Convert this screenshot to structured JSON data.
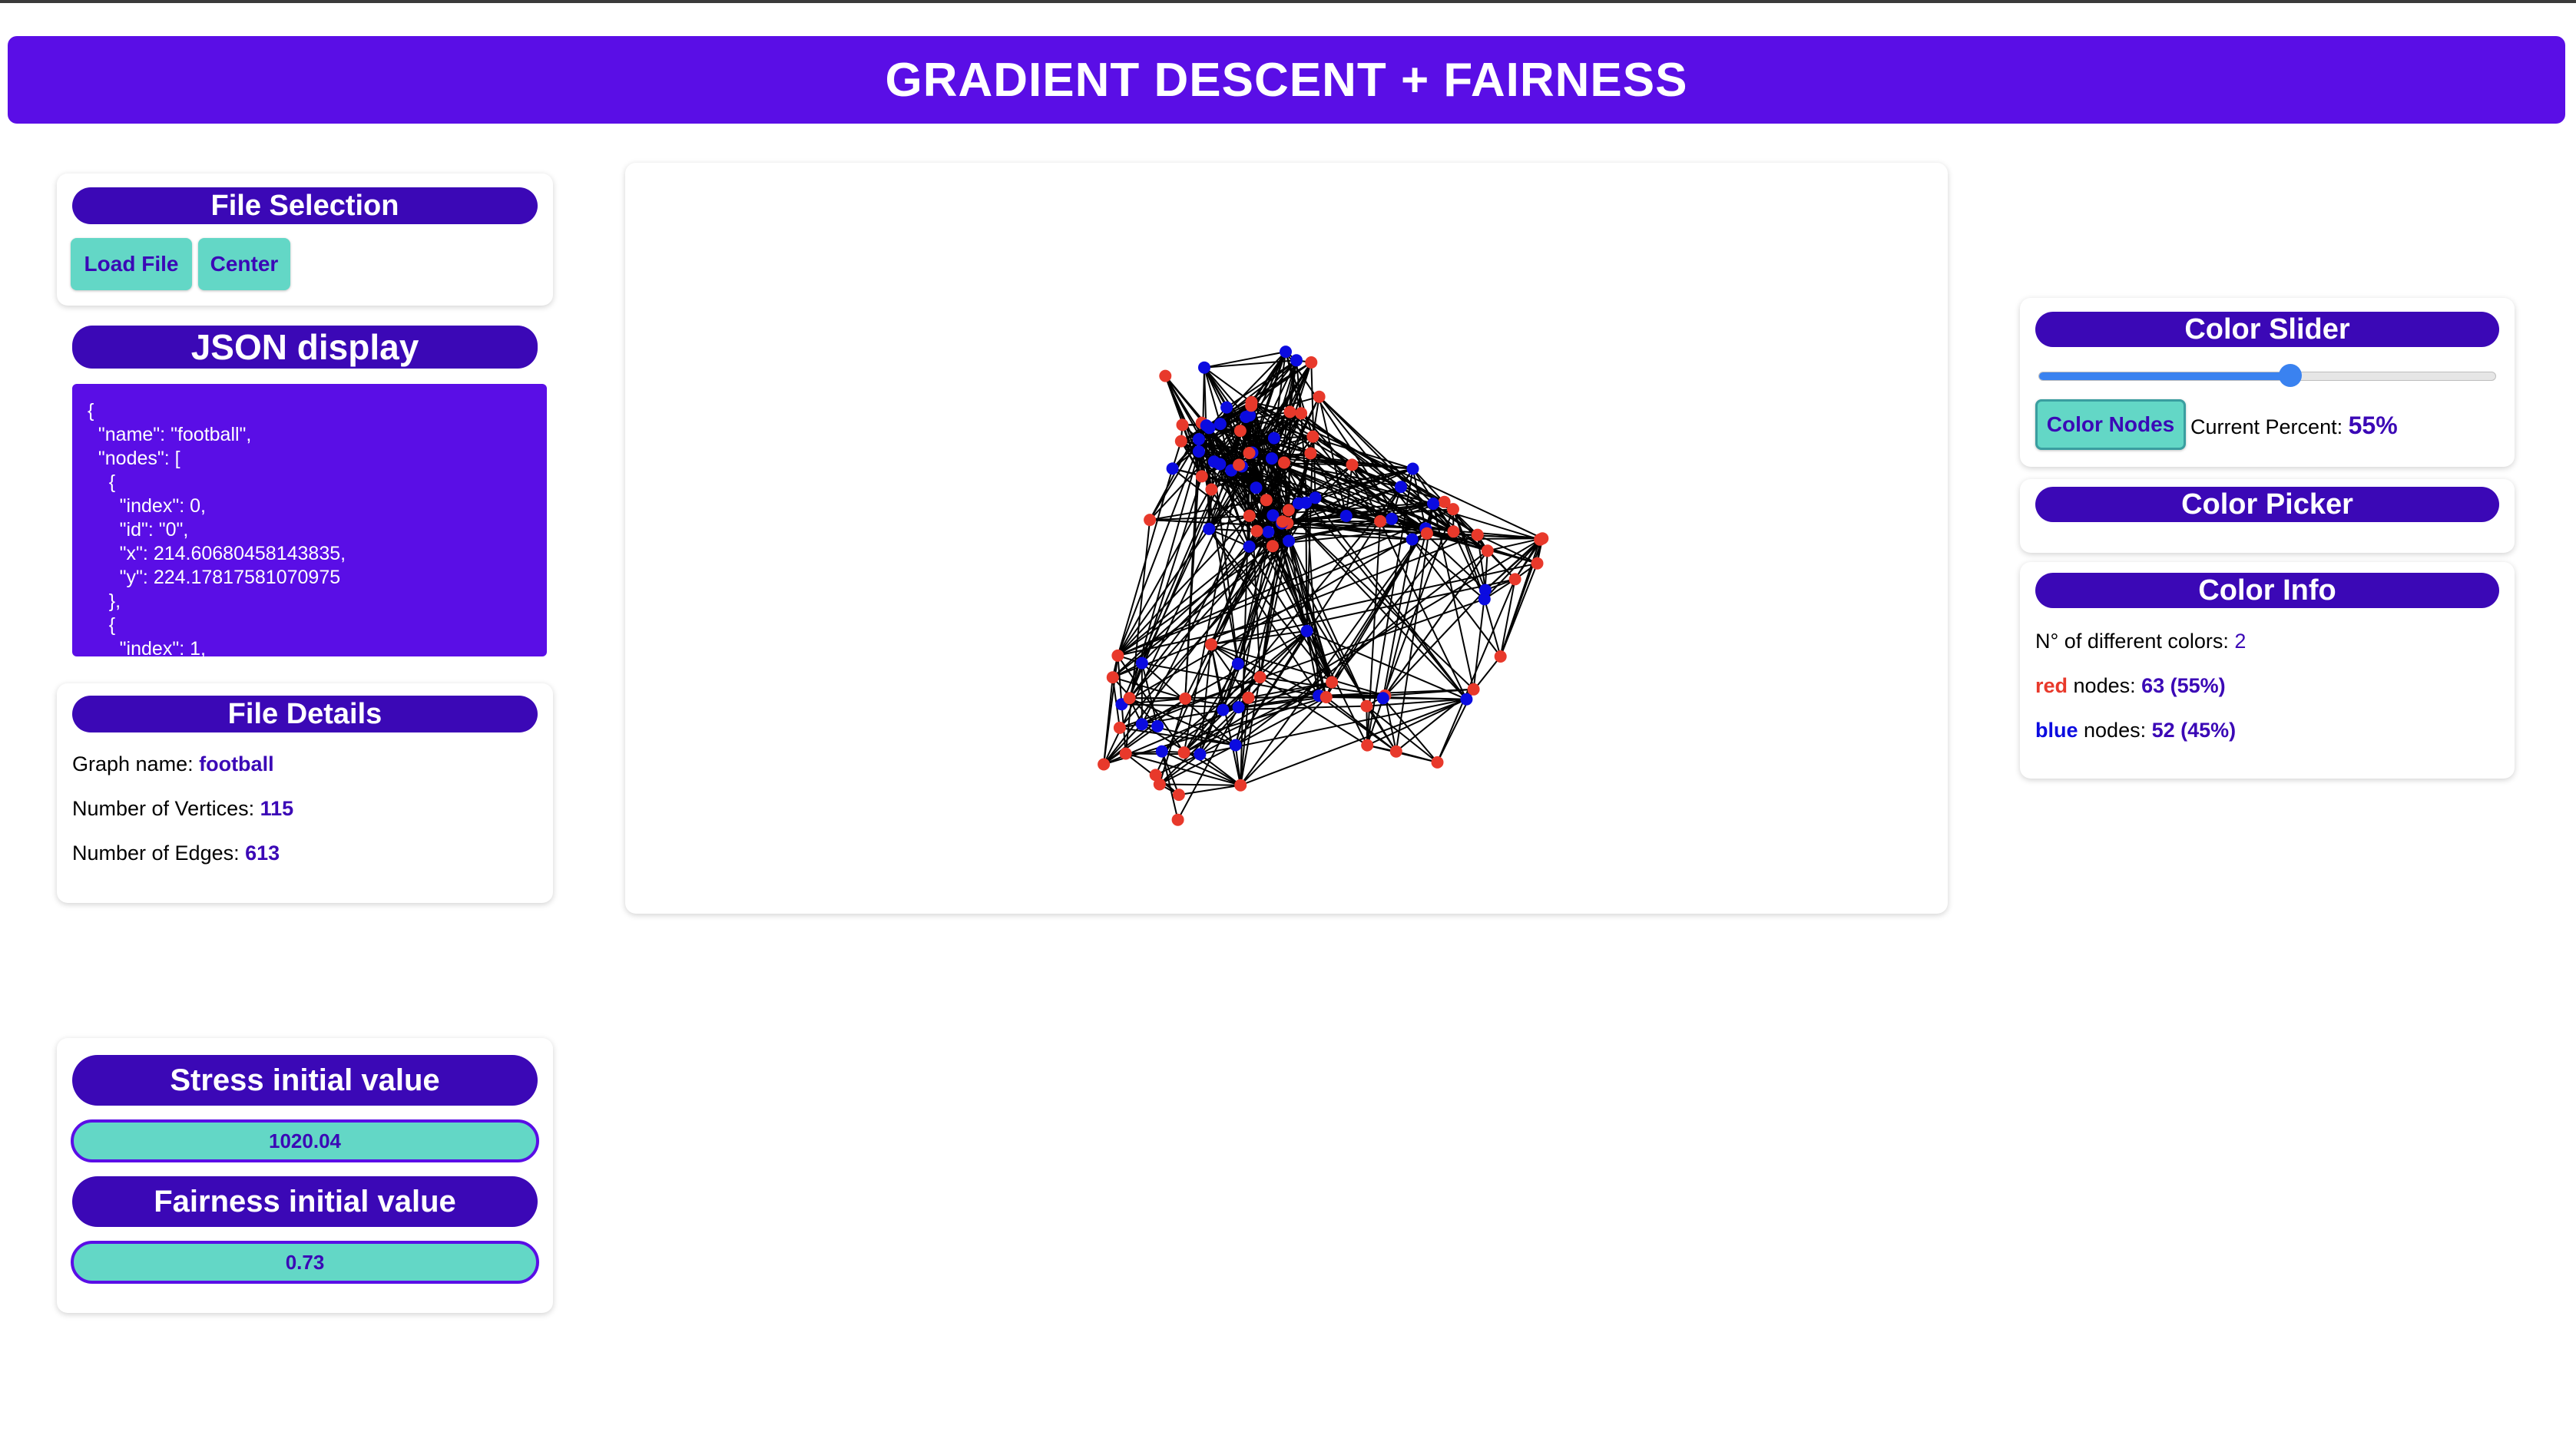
{
  "app": {
    "title": "GRADIENT DESCENT + FAIRNESS"
  },
  "file_selection": {
    "title": "File Selection",
    "load_label": "Load File",
    "center_label": "Center"
  },
  "json_display": {
    "title": "JSON display",
    "content": "{\n  \"name\": \"football\",\n  \"nodes\": [\n    {\n      \"index\": 0,\n      \"id\": \"0\",\n      \"x\": 214.60680458143835,\n      \"y\": 224.17817581070975\n    },\n    {\n      \"index\": 1,"
  },
  "file_details": {
    "title": "File Details",
    "graph_name_label": "Graph name: ",
    "graph_name": "football",
    "vertices_label": "Number of Vertices: ",
    "vertices": "115",
    "edges_label": "Number of Edges: ",
    "edges": "613"
  },
  "metrics": {
    "stress_title": "Stress initial value",
    "stress_value": "1020.04",
    "fairness_title": "Fairness initial value",
    "fairness_value": "0.73"
  },
  "color_slider": {
    "title": "Color Slider",
    "button_label": "Color Nodes",
    "percent_label": "Current Percent: ",
    "percent_value": "55%",
    "percent": 55
  },
  "color_picker": {
    "title": "Color Picker"
  },
  "color_info": {
    "title": "Color Info",
    "count_label": "N° of different colors: ",
    "count": "2",
    "red_name": "red",
    "red_suffix": " nodes: ",
    "red_value": "63 (55%)",
    "blue_name": "blue",
    "blue_suffix": " nodes: ",
    "blue_value": "52 (45%)"
  },
  "graph": {
    "red_color": "#e8392b",
    "blue_color": "#0b0be0",
    "edge_color": "#000000",
    "red_count": 63,
    "blue_count": 52,
    "edge_count": 613
  },
  "colors": {
    "accent": "#5a0ee6",
    "pill": "#3b08b6",
    "button": "#63d7c6"
  }
}
